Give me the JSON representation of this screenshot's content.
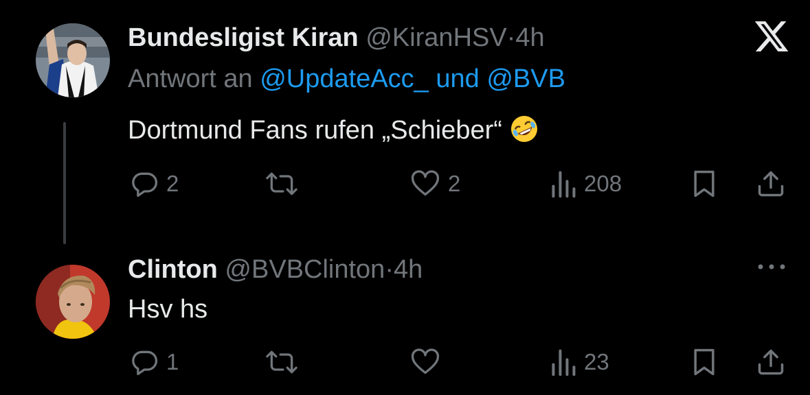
{
  "tweets": [
    {
      "name": "Bundesligist Kiran",
      "handle": "@KiranHSV",
      "separator": "·",
      "time": "4h",
      "reply_prefix": "Antwort an",
      "reply_mentions": "@UpdateAcc_ und @BVB",
      "text": "Dortmund Fans rufen „Schieber“",
      "emoji": "rolling-on-floor-laughing",
      "corner_icon": "x-logo-icon",
      "replies": "2",
      "retweets": "",
      "likes": "2",
      "views": "208"
    },
    {
      "name": "Clinton",
      "handle": "@BVBClinton",
      "separator": "·",
      "time": "4h",
      "text": "Hsv hs",
      "corner_icon": "more-icon",
      "replies": "1",
      "retweets": "",
      "likes": "",
      "views": "23"
    }
  ],
  "colors": {
    "background": "#000000",
    "primary_text": "#e7e9ea",
    "secondary_text": "#71767b",
    "link": "#1d9bf0",
    "thread_line": "#3a3d40"
  }
}
